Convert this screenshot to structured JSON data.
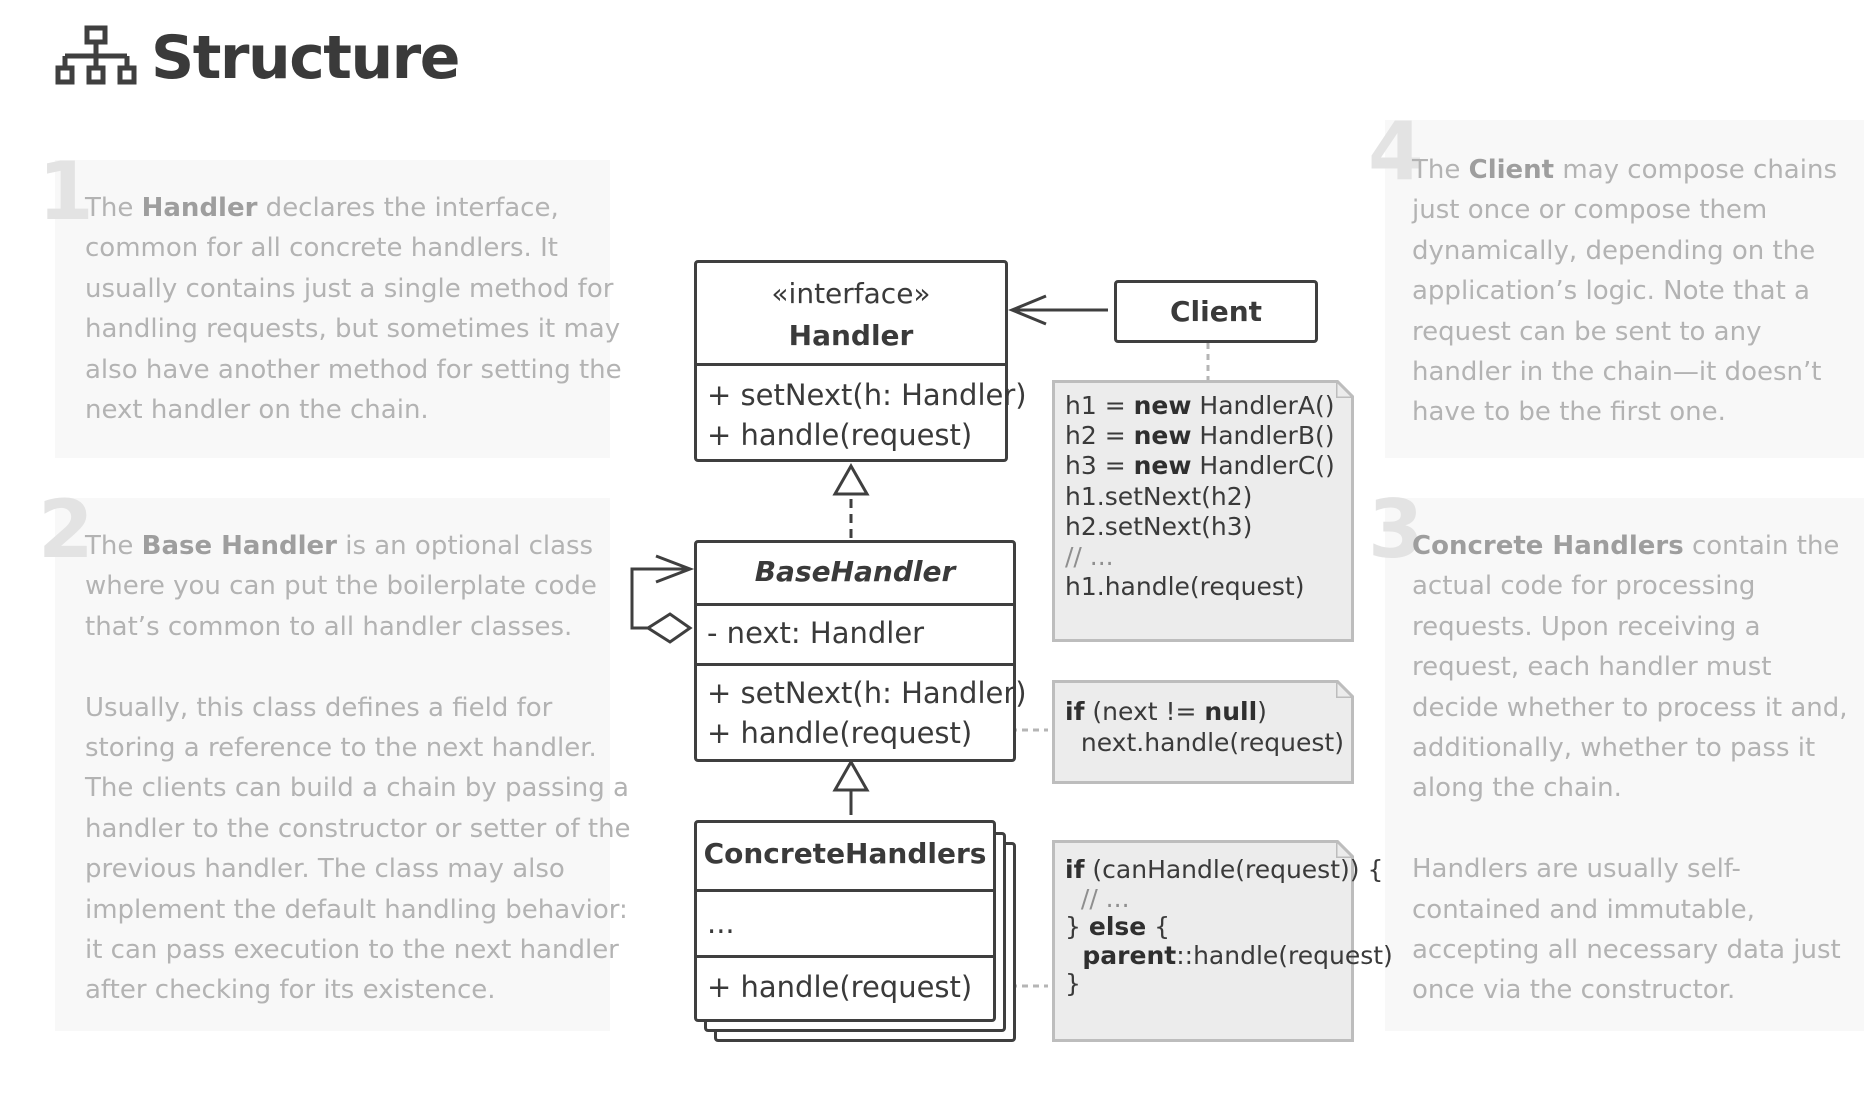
{
  "header": {
    "title": "Structure",
    "icon": "hierarchy-icon"
  },
  "panels": {
    "p1": {
      "number": "1",
      "lines": [
        {
          "pre": "The ",
          "bold": "Handler",
          "post": " declares the interface,"
        },
        {
          "pre": "common for all concrete handlers. It"
        },
        {
          "pre": "usually contains just a single method for"
        },
        {
          "pre": "handling requests, but sometimes it may"
        },
        {
          "pre": "also have another method for setting the"
        },
        {
          "pre": "next handler on the chain."
        }
      ]
    },
    "p2": {
      "number": "2",
      "lines": [
        {
          "pre": "The ",
          "bold": "Base Handler",
          "post": " is an optional class"
        },
        {
          "pre": "where you can put the boilerplate code"
        },
        {
          "pre": "that’s common to all handler classes."
        },
        {
          "gap": true
        },
        {
          "pre": "Usually, this class defines a field for"
        },
        {
          "pre": "storing a reference to the next handler."
        },
        {
          "pre": "The clients can build a chain by passing a"
        },
        {
          "pre": "handler to the constructor or setter of the"
        },
        {
          "pre": "previous handler. The class may also"
        },
        {
          "pre": "implement the default handling behavior:"
        },
        {
          "pre": "it can pass execution to the next handler"
        },
        {
          "pre": "after checking for its existence."
        }
      ]
    },
    "p4": {
      "number": "4",
      "lines": [
        {
          "pre": "The ",
          "bold": "Client",
          "post": " may compose chains"
        },
        {
          "pre": "just once or compose them"
        },
        {
          "pre": "dynamically, depending on the"
        },
        {
          "pre": "application’s logic. Note that a"
        },
        {
          "pre": "request can be sent to any"
        },
        {
          "pre": "handler in the chain—it doesn’t"
        },
        {
          "pre": "have to be the first one."
        }
      ]
    },
    "p3": {
      "number": "3",
      "lines": [
        {
          "pre": "",
          "bold": "Concrete Handlers",
          "post": " contain the"
        },
        {
          "pre": "actual code for processing"
        },
        {
          "pre": "requests. Upon receiving a"
        },
        {
          "pre": "request, each handler must"
        },
        {
          "pre": "decide whether to process it and,"
        },
        {
          "pre": "additionally, whether to pass it"
        },
        {
          "pre": "along the chain."
        },
        {
          "gap": true
        },
        {
          "pre": "Handlers are usually self-"
        },
        {
          "pre": "contained and immutable,"
        },
        {
          "pre": "accepting all necessary data just"
        },
        {
          "pre": "once via the constructor."
        }
      ]
    }
  },
  "uml": {
    "handler": {
      "stereotype": "«interface»",
      "name": "Handler",
      "methods": [
        "+ setNext(h: Handler)",
        "+ handle(request)"
      ]
    },
    "client": {
      "name": "Client"
    },
    "base_handler": {
      "name": "BaseHandler",
      "fields": [
        "- next: Handler"
      ],
      "methods": [
        "+ setNext(h: Handler)",
        "+ handle(request)"
      ]
    },
    "concrete_handlers": {
      "name": "ConcreteHandlers",
      "fields": [
        "..."
      ],
      "methods": [
        "+ handle(request)"
      ]
    }
  },
  "notes": {
    "client_note": [
      {
        "a": "h1 = ",
        "b": "new",
        "c": " HandlerA()"
      },
      {
        "a": "h2 = ",
        "b": "new",
        "c": " HandlerB()"
      },
      {
        "a": "h3 = ",
        "b": "new",
        "c": " HandlerC()"
      },
      {
        "a": "h1.setNext(h2)"
      },
      {
        "a": "h2.setNext(h3)"
      },
      {
        "cm": "// ..."
      },
      {
        "a": "h1.handle(request)"
      }
    ],
    "base_note": [
      {
        "b": "if",
        "a": " (next != ",
        "b2": "null",
        "c": ")"
      },
      {
        "a": "  next.handle(request)"
      }
    ],
    "concrete_note": [
      {
        "b": "if",
        "a": " (canHandle(request)) {"
      },
      {
        "cm": "  // ..."
      },
      {
        "a": "} ",
        "b2": "else",
        "c": " {"
      },
      {
        "b": "  parent",
        "a": "::handle(request)"
      },
      {
        "a": "}"
      }
    ]
  }
}
